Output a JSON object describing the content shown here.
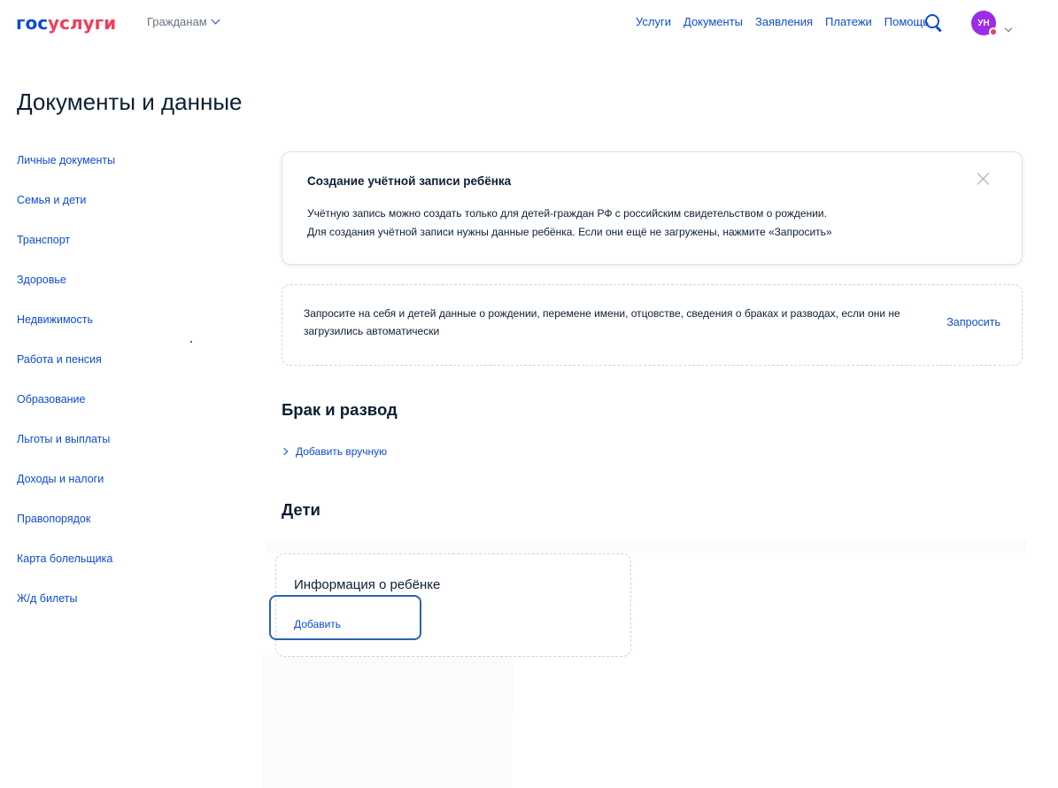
{
  "header": {
    "logo_part1": "гос",
    "logo_part2": "услуги",
    "role": "Гражданам",
    "nav": [
      "Услуги",
      "Документы",
      "Заявления",
      "Платежи",
      "Помощь"
    ],
    "avatar_initials": "УН",
    "search_icon": "search-icon",
    "brand_color": "#0d4cd3",
    "accent_color": "#ee3f58",
    "avatar_color": "#9b2ce8"
  },
  "page": {
    "title": "Документы и данные"
  },
  "sidebar": {
    "items": [
      "Личные документы",
      "Семья и дети",
      "Транспорт",
      "Здоровье",
      "Недвижимость",
      "Работа и пенсия",
      "Образование",
      "Льготы и выплаты",
      "Доходы и налоги",
      "Правопорядок",
      "Карта болельщика",
      "Ж/д билеты"
    ]
  },
  "info_card": {
    "title": "Создание учётной записи ребёнка",
    "line1": "Учётную запись можно создать только для детей-граждан РФ с российским свидетельством о рождении.",
    "line2": "Для создания учётной записи нужны данные ребёнка. Если они ещё не загружены, нажмите «Запросить»"
  },
  "request_card": {
    "text": "Запросите на себя и детей данные о рождении, перемене имени, отцовстве, сведения о браках и разводах, если они не загрузились автоматически",
    "button": "Запросить"
  },
  "marriage": {
    "title": "Брак и развод",
    "add_manual": "Добавить вручную"
  },
  "children": {
    "title": "Дети",
    "card_title": "Информация о ребёнке",
    "add_link": "Добавить"
  }
}
